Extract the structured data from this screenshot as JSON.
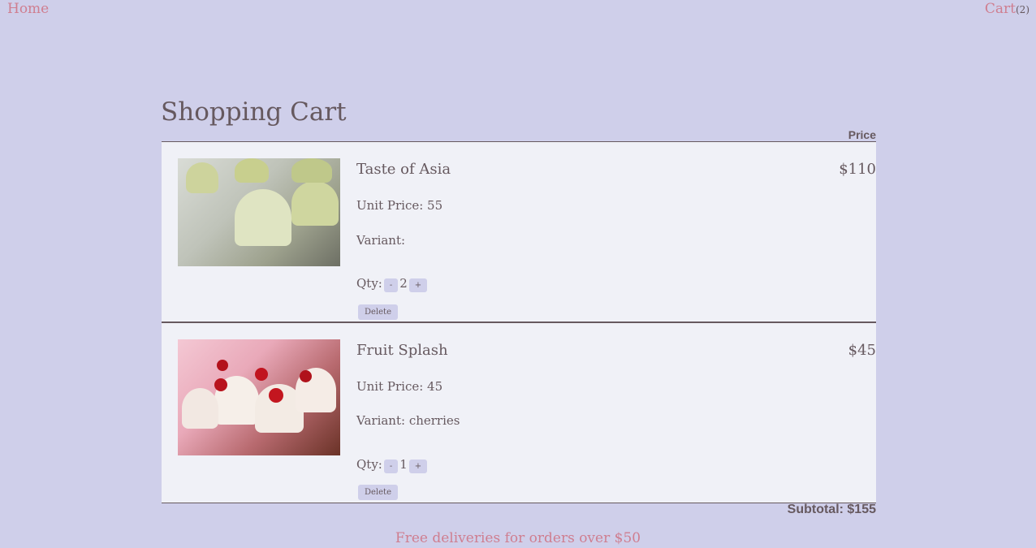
{
  "nav": {
    "home": "Home",
    "cart": "Cart",
    "cart_count": "(2)"
  },
  "page": {
    "title": "Shopping Cart",
    "price_header": "Price"
  },
  "items": [
    {
      "name": "Taste of Asia",
      "price": "$110",
      "unit_price": "Unit Price: 55",
      "variant": "Variant:",
      "qty_label": "Qty:",
      "qty": "2",
      "minus": "-",
      "plus": "+",
      "delete": "Delete"
    },
    {
      "name": "Fruit Splash",
      "price": "$45",
      "unit_price": "Unit Price: 45",
      "variant": "Variant: cherries",
      "qty_label": "Qty:",
      "qty": "1",
      "minus": "-",
      "plus": "+",
      "delete": "Delete"
    }
  ],
  "summary": {
    "subtotal": "Subtotal: $155",
    "free_delivery": "Free deliveries for orders over $50"
  },
  "colors": {
    "background": "#cfcfea",
    "row_bg": "#f0f1f7",
    "text": "#66595f",
    "accent": "#cf7e90"
  }
}
